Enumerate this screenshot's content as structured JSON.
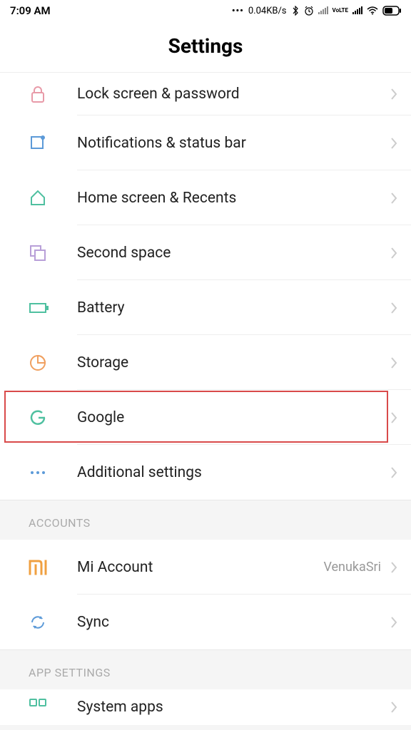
{
  "status": {
    "time": "7:09 AM",
    "speed": "0.04KB/s",
    "volte": "VoLTE"
  },
  "header": {
    "title": "Settings"
  },
  "items": [
    {
      "label": "Lock screen & password"
    },
    {
      "label": "Notifications & status bar"
    },
    {
      "label": "Home screen & Recents"
    },
    {
      "label": "Second space"
    },
    {
      "label": "Battery"
    },
    {
      "label": "Storage"
    },
    {
      "label": "Google"
    },
    {
      "label": "Additional settings"
    }
  ],
  "sections": {
    "accounts": {
      "title": "ACCOUNTS",
      "items": [
        {
          "label": "Mi Account",
          "value": "VenukaSri"
        },
        {
          "label": "Sync"
        }
      ]
    },
    "app_settings": {
      "title": "APP SETTINGS",
      "items": [
        {
          "label": "System apps"
        }
      ]
    }
  }
}
